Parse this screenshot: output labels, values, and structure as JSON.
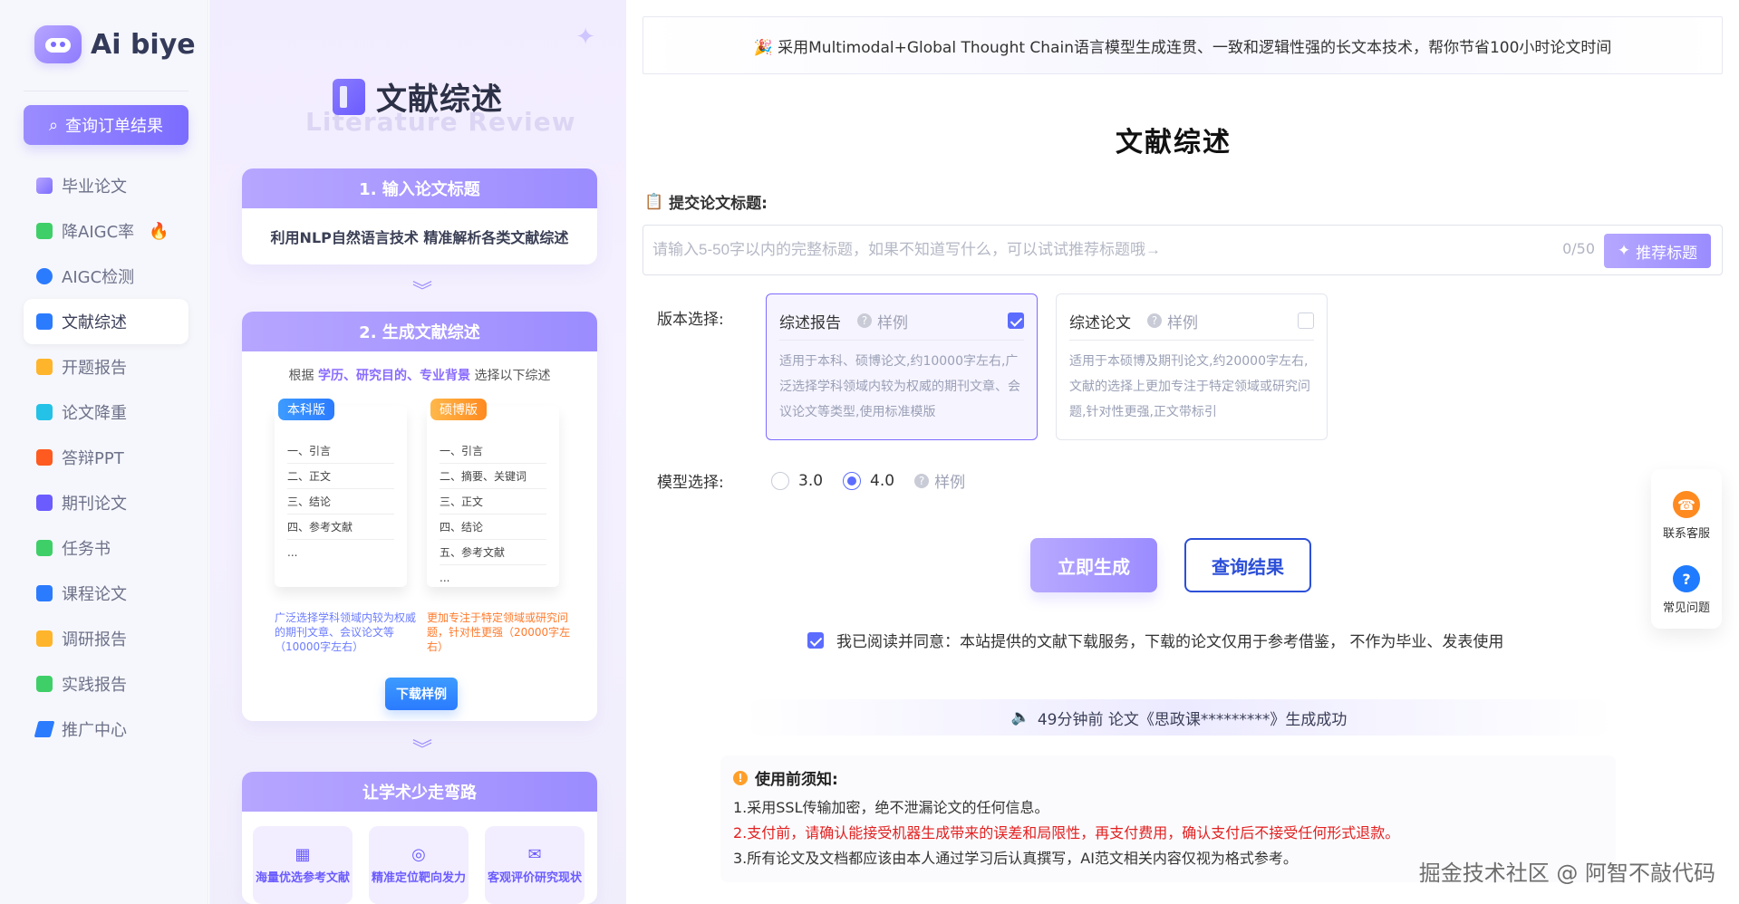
{
  "brand": {
    "name": "Ai biye"
  },
  "sidebar": {
    "query_button": "查询订单结果",
    "items": [
      {
        "label": "毕业论文",
        "icon": "graduation-cap-icon"
      },
      {
        "label": "降AIGC率",
        "icon": "ai-icon",
        "badge": "🔥"
      },
      {
        "label": "AIGC检测",
        "icon": "ai-detect-icon"
      },
      {
        "label": "文献综述",
        "icon": "book-icon",
        "active": true
      },
      {
        "label": "开题报告",
        "icon": "document-icon"
      },
      {
        "label": "论文降重",
        "icon": "chart-icon"
      },
      {
        "label": "答辩PPT",
        "icon": "ppt-icon"
      },
      {
        "label": "期刊论文",
        "icon": "journal-icon"
      },
      {
        "label": "任务书",
        "icon": "check-icon"
      },
      {
        "label": "课程论文",
        "icon": "course-icon"
      },
      {
        "label": "调研报告",
        "icon": "report-icon"
      },
      {
        "label": "实践报告",
        "icon": "practice-icon"
      },
      {
        "label": "推广中心",
        "icon": "send-icon"
      }
    ]
  },
  "promo": {
    "title": "文献综述",
    "subtitle": "Literature Review",
    "card1": {
      "header": "1. 输入论文标题",
      "text": "利用NLP自然语言技术   精准解析各类文献综述"
    },
    "card2": {
      "header": "2. 生成文献综述",
      "pre_a": "根据",
      "pre_hl": "学历、研究目的、专业背景",
      "pre_b": "选择以下综述",
      "left": {
        "tag": "本科版",
        "items": [
          "一、引言",
          "二、正文",
          "三、结论",
          "四、参考文献",
          "..."
        ],
        "note": "广泛选择学科领域内较为权威的期刊文章、会议论文等（10000字左右）"
      },
      "right": {
        "tag": "硕博版",
        "items": [
          "一、引言",
          "二、摘要、关键词",
          "三、正文",
          "四、结论",
          "五、参考文献",
          "..."
        ],
        "note": "更加专注于特定领域或研究问题，针对性更强（20000字左右）"
      },
      "download": "下载样例"
    },
    "card3": {
      "header": "让学术少走弯路",
      "items": [
        {
          "label": "海量优选参考文献",
          "icon": "library-icon"
        },
        {
          "label": "精准定位靶向发力",
          "icon": "target-icon"
        },
        {
          "label": "客观评价研究现状",
          "icon": "chat-icon"
        }
      ]
    }
  },
  "main": {
    "banner": "🎉 采用Multimodal+Global Thought Chain语言模型生成连贯、一致和逻辑性强的长文本技术，帮你节省100小时论文时间",
    "title": "文献综述",
    "submit_label": "提交论文标题:",
    "input_placeholder": "请输入5-50字以内的完整标题，如果不知道写什么，可以试试推荐标题哦→",
    "counter": "0/50",
    "suggest": "推荐标题",
    "version_label": "版本选择:",
    "options": [
      {
        "title": "综述报告",
        "sample": "样例",
        "checked": true,
        "desc": "适用于本科、硕博论文,约10000字左右,广泛选择学科领域内较为权威的期刊文章、会议论文等类型,使用标准模版"
      },
      {
        "title": "综述论文",
        "sample": "样例",
        "checked": false,
        "desc": "适用于本硕博及期刊论文,约20000字左右,文献的选择上更加专注于特定领域或研究问题,针对性更强,正文带标引"
      }
    ],
    "model_label": "模型选择:",
    "models": [
      {
        "label": "3.0",
        "checked": false
      },
      {
        "label": "4.0",
        "checked": true
      }
    ],
    "model_sample": "样例",
    "generate_btn": "立即生成",
    "query_btn": "查询结果",
    "agree_text": "我已阅读并同意：本站提供的文献下载服务，下载的论文仅用于参考借鉴，  不作为毕业、发表使用",
    "scroll_note": "49分钟前 论文《思政课*********》生成成功",
    "notice": {
      "title": "使用前须知:",
      "l1": "1.采用SSL传输加密，绝不泄漏论文的任何信息。",
      "l2": "2.支付前，请确认能接受机器生成带来的误差和局限性，再支付费用，确认支付后不接受任何形式退款。",
      "l3": "3.所有论文及文档都应该由本人通过学习后认真撰写，AI范文相关内容仅视为格式参考。"
    },
    "watermark": "掘金技术社区 @ 阿智不敲代码"
  },
  "float": {
    "service": "联系客服",
    "faq": "常见问题"
  },
  "colors": {
    "accent": "#7b6cff",
    "primary_blue": "#2c4fd8",
    "red_notice": "#e21f1f"
  }
}
